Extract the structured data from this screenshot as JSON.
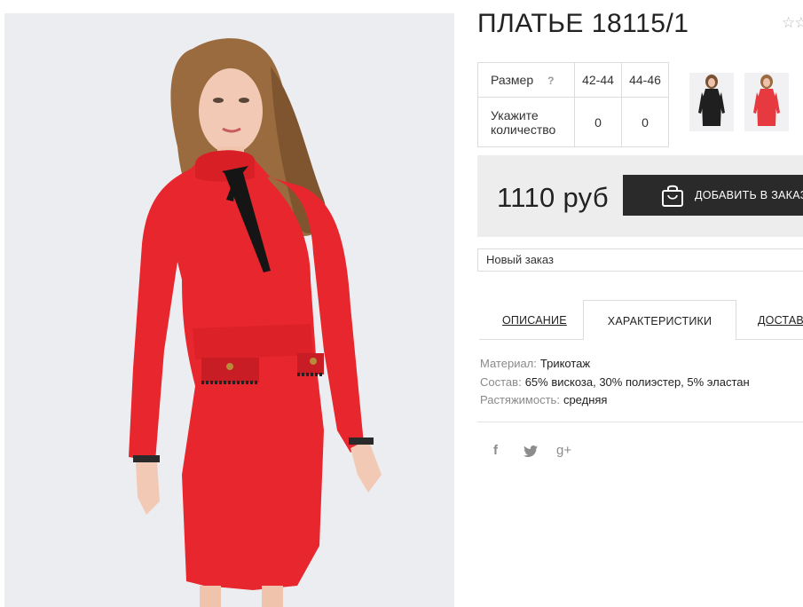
{
  "product": {
    "title": "ПЛАТЬЕ 18115/1",
    "stars": "☆☆"
  },
  "size_table": {
    "size_label": "Размер",
    "help_icon": "?",
    "sizes": [
      "42-44",
      "44-46"
    ],
    "quantity_label_line1": "Укажите",
    "quantity_label_line2": "количество",
    "quantities": [
      "0",
      "0"
    ]
  },
  "thumbnails": [
    {
      "icon": "dress-black-thumbnail",
      "color": "#1f1f1f"
    },
    {
      "icon": "dress-red-thumbnail",
      "color": "#e63940"
    }
  ],
  "purchase": {
    "price": "1110 руб",
    "add_to_order_label": "ДОБАВИТЬ В ЗАКАЗ",
    "order_select_value": "Новый заказ"
  },
  "tabs": {
    "description": "ОПИСАНИЕ",
    "characteristics": "ХАРАКТЕРИСТИКИ",
    "delivery": "ДОСТАВКА"
  },
  "specs": {
    "material_label": "Материал:",
    "material_value": "Трикотаж",
    "composition_label": "Состав:",
    "composition_value": "65% вискоза, 30% полиэстер, 5% эластан",
    "stretch_label": "Растяжимость:",
    "stretch_value": "средняя"
  },
  "social": {
    "facebook": "f",
    "twitter": "twitter-icon",
    "google_plus": "g+"
  },
  "colors": {
    "dress_red": "#e8262d",
    "button_dark": "#2a2a2a",
    "price_panel": "#ededed"
  }
}
